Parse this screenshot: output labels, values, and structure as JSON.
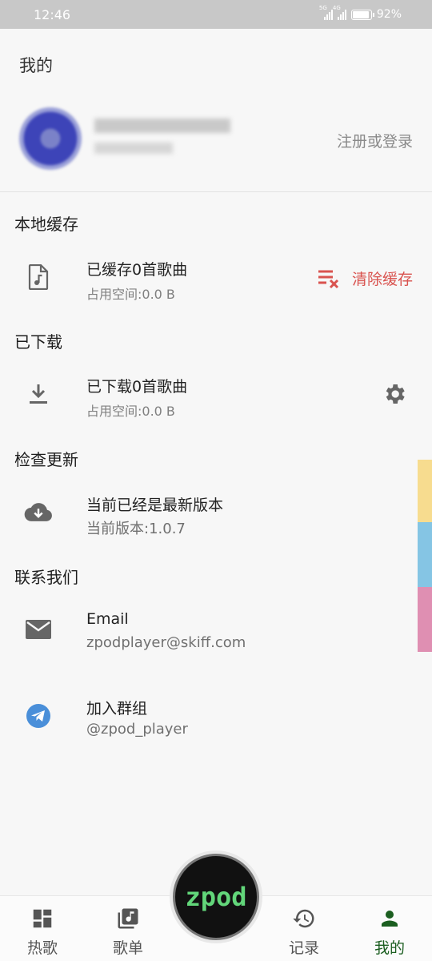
{
  "status_bar": {
    "time": "12:46",
    "net1": "5G",
    "net2": "4G",
    "battery": "92%"
  },
  "page_title": "我的",
  "profile": {
    "login_label": "注册或登录"
  },
  "local_cache": {
    "section_title": "本地缓存",
    "title": "已缓存0首歌曲",
    "subtitle": "占用空间:0.0 B",
    "clear_label": "清除缓存"
  },
  "downloaded": {
    "section_title": "已下载",
    "title": "已下载0首歌曲",
    "subtitle": "占用空间:0.0 B"
  },
  "update": {
    "section_title": "检查更新",
    "title": "当前已经是最新版本",
    "subtitle": "当前版本:1.0.7"
  },
  "contact": {
    "section_title": "联系我们",
    "email_title": "Email",
    "email_value": "zpodplayer@skiff.com",
    "group_title": "加入群组",
    "group_value": "@zpod_player"
  },
  "bottom_nav": {
    "items": [
      {
        "label": "热歌",
        "icon": "dashboard-icon"
      },
      {
        "label": "歌单",
        "icon": "playlist-icon"
      },
      {
        "label": "记录",
        "icon": "history-icon"
      },
      {
        "label": "我的",
        "icon": "person-icon"
      }
    ],
    "center_label": "zpod"
  },
  "colors": {
    "accent_red": "#d9534f",
    "active_nav": "#1b5e20",
    "side_yellow": "#f7dc8f",
    "side_blue": "#85c5e4",
    "side_pink": "#df8fb2",
    "telegram_blue": "#4a8fd9",
    "fab_text": "#62d67a"
  }
}
